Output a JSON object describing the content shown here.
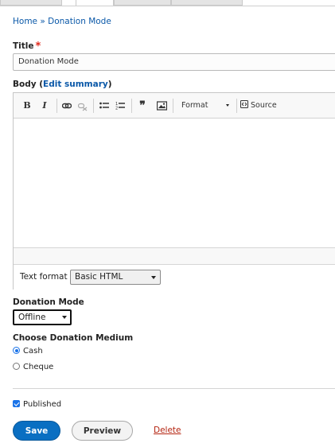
{
  "breadcrumb": {
    "home": "Home",
    "separator": "»",
    "current": "Donation Mode"
  },
  "title_field": {
    "label": "Title",
    "required_mark": "*",
    "value": "Donation Mode"
  },
  "body_field": {
    "label": "Body",
    "edit_summary": "Edit summary"
  },
  "toolbar": {
    "bold": "B",
    "italic": "I",
    "format_label": "Format",
    "source_label": "Source"
  },
  "text_format": {
    "label": "Text format",
    "selected": "Basic HTML"
  },
  "donation_mode": {
    "label": "Donation Mode",
    "selected": "Offline"
  },
  "donation_medium": {
    "label": "Choose Donation Medium",
    "options": [
      "Cash",
      "Cheque"
    ],
    "selected": "Cash"
  },
  "published": {
    "label": "Published",
    "checked": true
  },
  "actions": {
    "save": "Save",
    "preview": "Preview",
    "delete": "Delete"
  },
  "colors": {
    "link": "#0a58a8",
    "primary_button": "#0a6fc2",
    "delete_link": "#b42410",
    "required": "#e1281b"
  }
}
